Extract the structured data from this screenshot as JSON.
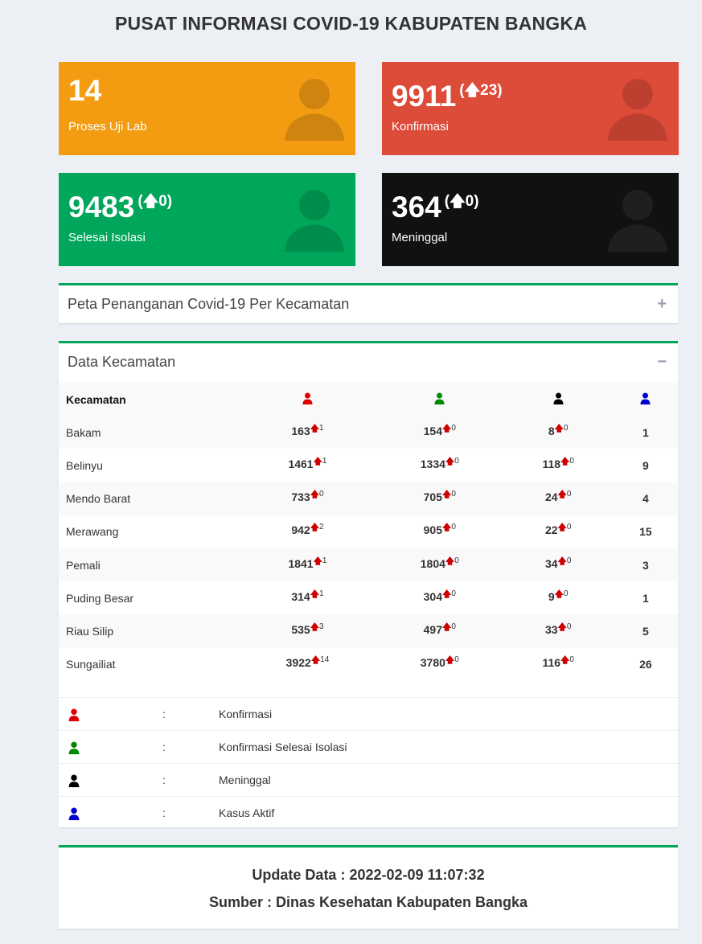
{
  "header": {
    "title": "PUSAT INFORMASI COVID-19 KABUPATEN BANGKA"
  },
  "stats": {
    "lab": {
      "value": "14",
      "label": "Proses Uji Lab",
      "color": "#f39c12"
    },
    "confirmed": {
      "value": "9911",
      "delta": "23",
      "label": "Konfirmasi",
      "color": "#dd4b39"
    },
    "recovered": {
      "value": "9483",
      "delta": "0",
      "label": "Selesai Isolasi",
      "color": "#00a65a"
    },
    "deaths": {
      "value": "364",
      "delta": "0",
      "label": "Meninggal",
      "color": "#111111"
    }
  },
  "map_panel": {
    "title": "Peta Penanganan Covid-19 Per Kecamatan",
    "toggle": "+"
  },
  "data_panel": {
    "title": "Data Kecamatan",
    "toggle": "−",
    "column_header": "Kecamatan",
    "rows": [
      {
        "name": "Bakam",
        "konfirmasi": "163",
        "k_delta": "1",
        "selesai": "154",
        "s_delta": "0",
        "meninggal": "8",
        "m_delta": "0",
        "aktif": "1"
      },
      {
        "name": "Belinyu",
        "konfirmasi": "1461",
        "k_delta": "1",
        "selesai": "1334",
        "s_delta": "0",
        "meninggal": "118",
        "m_delta": "0",
        "aktif": "9"
      },
      {
        "name": "Mendo Barat",
        "konfirmasi": "733",
        "k_delta": "0",
        "selesai": "705",
        "s_delta": "0",
        "meninggal": "24",
        "m_delta": "0",
        "aktif": "4"
      },
      {
        "name": "Merawang",
        "konfirmasi": "942",
        "k_delta": "2",
        "selesai": "905",
        "s_delta": "0",
        "meninggal": "22",
        "m_delta": "0",
        "aktif": "15"
      },
      {
        "name": "Pemali",
        "konfirmasi": "1841",
        "k_delta": "1",
        "selesai": "1804",
        "s_delta": "0",
        "meninggal": "34",
        "m_delta": "0",
        "aktif": "3"
      },
      {
        "name": "Puding Besar",
        "konfirmasi": "314",
        "k_delta": "1",
        "selesai": "304",
        "s_delta": "0",
        "meninggal": "9",
        "m_delta": "0",
        "aktif": "1"
      },
      {
        "name": "Riau Silip",
        "konfirmasi": "535",
        "k_delta": "3",
        "selesai": "497",
        "s_delta": "0",
        "meninggal": "33",
        "m_delta": "0",
        "aktif": "5"
      },
      {
        "name": "Sungailiat",
        "konfirmasi": "3922",
        "k_delta": "14",
        "selesai": "3780",
        "s_delta": "0",
        "meninggal": "116",
        "m_delta": "0",
        "aktif": "26"
      }
    ],
    "legend": [
      {
        "icon": "user-icon",
        "color": "#dd0000",
        "sep": ":",
        "label": "Konfirmasi"
      },
      {
        "icon": "user-icon",
        "color": "#008800",
        "sep": ":",
        "label": "Konfirmasi Selesai Isolasi"
      },
      {
        "icon": "user-icon",
        "color": "#000000",
        "sep": ":",
        "label": "Meninggal"
      },
      {
        "icon": "user-icon",
        "color": "#0000cc",
        "sep": ":",
        "label": "Kasus Aktif"
      }
    ]
  },
  "footer": {
    "update": "Update Data : 2022-02-09 11:07:32",
    "source": "Sumber : Dinas Kesehatan Kabupaten Bangka"
  },
  "colors": {
    "confirmed_icon": "#dd0000",
    "recovered_icon": "#008800",
    "death_icon": "#000000",
    "active_icon": "#0000cc",
    "arrow": "#cc0000",
    "panel_border": "#00a65a"
  }
}
